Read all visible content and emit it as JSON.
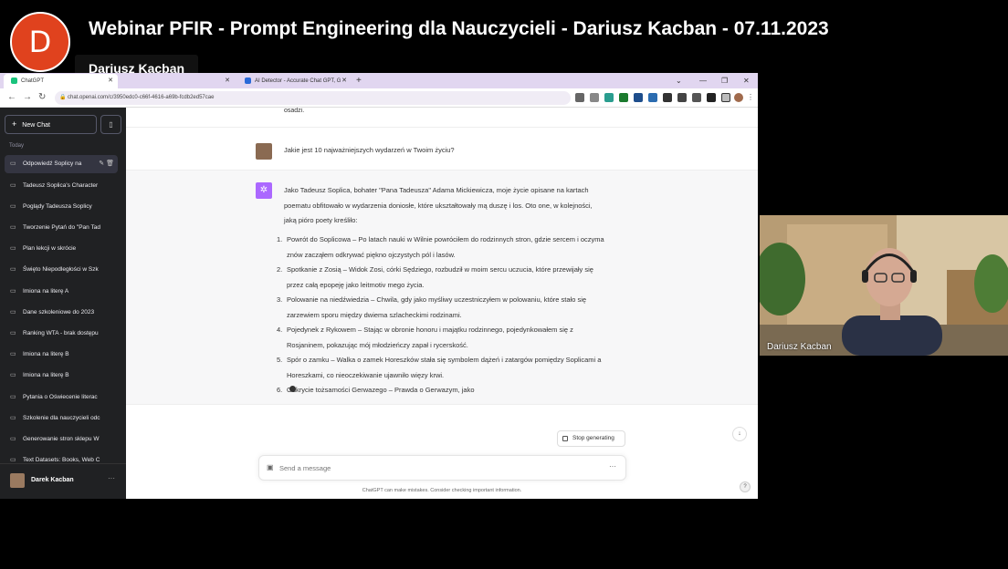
{
  "header": {
    "avatar_letter": "D",
    "title": "Webinar PFIR - Prompt Engineering dla Nauczycieli - Dariusz Kacban - 07.11.2023",
    "speaker_name": "Dariusz Kacban"
  },
  "browser": {
    "tabs": [
      {
        "label": "ChatGPT",
        "active": true
      },
      {
        "label": "",
        "active": false
      },
      {
        "label": "AI Detector - Accurate Chat GPT, G",
        "active": false
      }
    ],
    "url": "chat.openai.com/c/3950edc0-c66f-4616-a69b-fcdb2ed57cae"
  },
  "sidebar": {
    "new_chat": "New Chat",
    "section": "Today",
    "items": [
      {
        "label": "Odpowiedź Soplicy na",
        "active": true
      },
      {
        "label": "Tadeusz Soplica's Character"
      },
      {
        "label": "Poglądy Tadeusza Soplicy"
      },
      {
        "label": "Tworzenie Pytań do \"Pan Tad"
      },
      {
        "label": "Plan lekcji w skrócie"
      },
      {
        "label": "Święto Niepodległości w Szk"
      },
      {
        "label": "Imiona na literę A"
      },
      {
        "label": "Dane szkoleniowe do 2023"
      },
      {
        "label": "Ranking WTA - brak dostępu"
      },
      {
        "label": "Imiona na literę B"
      },
      {
        "label": "Imiona na literę B"
      },
      {
        "label": "Pytania o Oświecenie literac"
      },
      {
        "label": "Szkolenie dla nauczycieli odc"
      },
      {
        "label": "Generowanie stron sklepu W"
      },
      {
        "label": "Text Datasets: Books, Web C"
      }
    ],
    "user_name": "Darek Kacban"
  },
  "chat": {
    "prev_tail": "osadzi.",
    "user_question": "Jakie jest 10 najważniejszych wydarzeń w Twoim życiu?",
    "bot_intro": "Jako Tadeusz Soplica, bohater \"Pana Tadeusza\" Adama Mickiewicza, moje życie opisane na kartach poematu obfitowało w wydarzenia doniosłe, które ukształtowały mą duszę i los. Oto one, w kolejności, jaką pióro poety kreśliło:",
    "bot_list": [
      "Powrót do Soplicowa – Po latach nauki w Wilnie powróciłem do rodzinnych stron, gdzie sercem i oczyma znów zacząłem odkrywać piękno ojczystych pól i lasów.",
      "Spotkanie z Zosią – Widok Zosi, córki Sędziego, rozbudził w moim sercu uczucia, które przewijały się przez całą epopeję jako leitmotiv mego życia.",
      "Polowanie na niedźwiedzia – Chwila, gdy jako myśliwy uczestniczyłem w polowaniu, które stało się zarzewiem sporu między dwiema szlacheckimi rodzinami.",
      "Pojedynek z Rykowem – Stając w obronie honoru i majątku rodzinnego, pojedynkowałem się z Rosjaninem, pokazując mój młodzieńczy zapał i rycerskość.",
      "Spór o zamku – Walka o zamek Horeszków stała się symbolem dążeń i zatargów pomiędzy Soplicami a Horeszkami, co nieoczekiwanie ujawniło więzy krwi.",
      "Odkrycie tożsamości Gerwazego – Prawda o Gerwazym, jako"
    ],
    "stop_label": "Stop generating",
    "composer_placeholder": "Send a message",
    "disclaimer": "ChatGPT can make mistakes. Consider checking important information."
  },
  "webcam": {
    "name": "Dariusz Kacban"
  }
}
